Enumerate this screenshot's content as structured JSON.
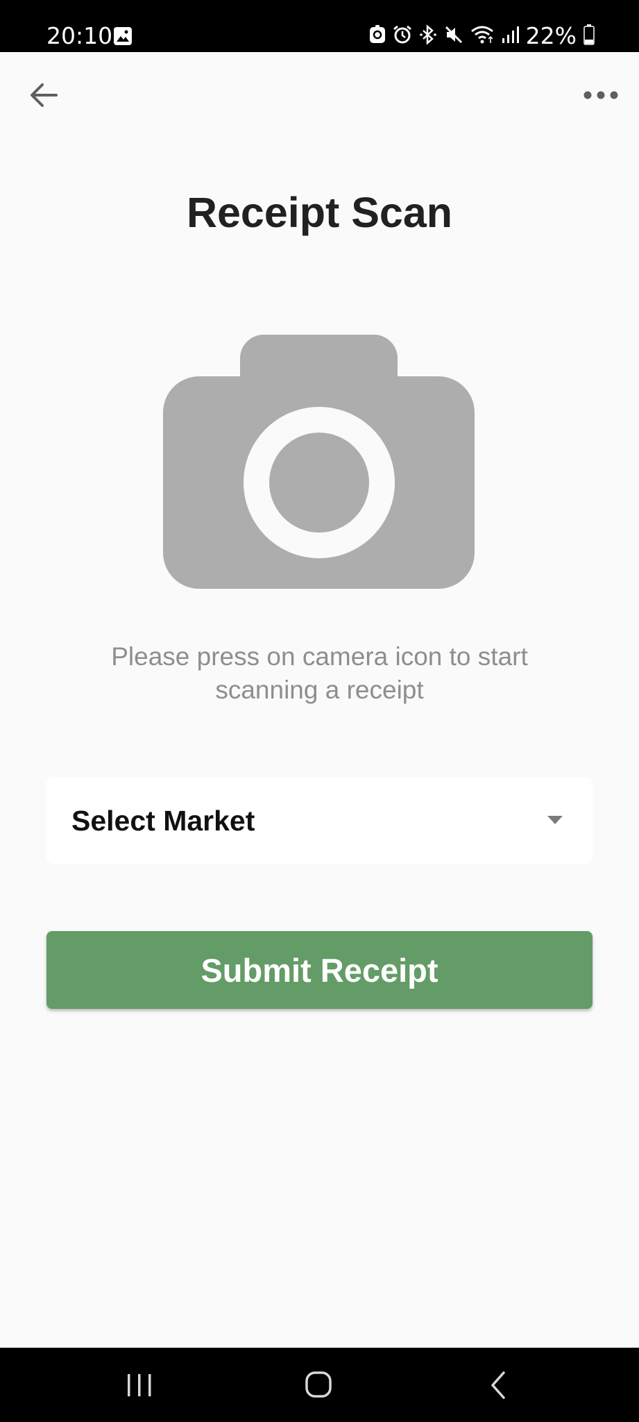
{
  "status_bar": {
    "time": "20:10",
    "battery_text": "22%",
    "icons": [
      "gallery-icon",
      "app-notification-icon",
      "alarm-icon",
      "bluetooth-icon",
      "mute-icon",
      "wifi-icon",
      "signal-icon",
      "battery-icon"
    ]
  },
  "app_bar": {
    "back_icon": "arrow-left-icon",
    "menu_icon": "more-horizontal-icon"
  },
  "page": {
    "title": "Receipt Scan",
    "camera_icon": "camera-icon",
    "hint": "Please press on camera icon to start scanning a receipt"
  },
  "market_select": {
    "selected_value": "Select Market",
    "icon": "dropdown-arrow-icon"
  },
  "submit": {
    "label": "Submit Receipt"
  },
  "colors": {
    "background": "#fafafa",
    "accent_green": "#639c67",
    "camera_gray": "#adadad",
    "hint_gray": "#8e8e8e",
    "title_dark": "#212121"
  },
  "nav_bar": {
    "items": [
      "recents-icon",
      "home-icon",
      "back-icon"
    ]
  }
}
